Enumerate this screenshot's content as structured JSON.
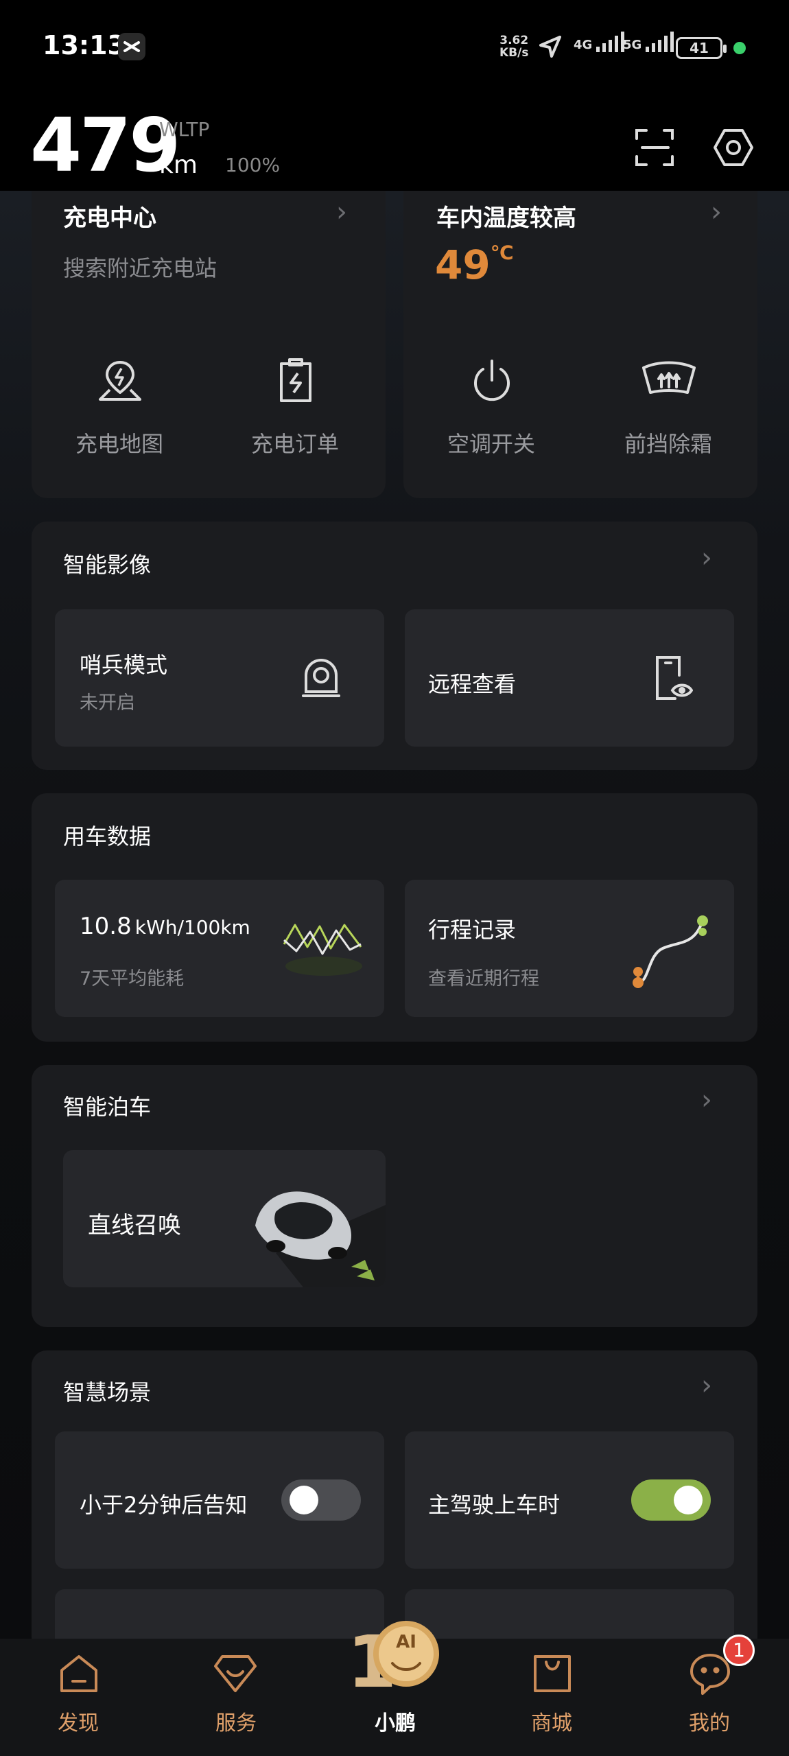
{
  "status_bar": {
    "time": "13:13",
    "net_speed_value": "3.62",
    "net_speed_unit": "KB/s",
    "sig1": "4G",
    "sig2": "5G",
    "battery": "41"
  },
  "header": {
    "range": "479",
    "standard": "WLTP",
    "unit": "km",
    "battery_pct": "100%"
  },
  "charging": {
    "title": "充电中心",
    "subtitle": "搜索附近充电站",
    "map_label": "充电地图",
    "orders_label": "充电订单"
  },
  "climate": {
    "title": "车内温度较高",
    "temp": "49",
    "temp_unit": "℃",
    "ac_label": "空调开关",
    "defrost_label": "前挡除霜"
  },
  "imaging": {
    "title": "智能影像",
    "sentry_title": "哨兵模式",
    "sentry_status": "未开启",
    "remote_view": "远程查看"
  },
  "vehicle_data": {
    "title": "用车数据",
    "energy_value": "10.8",
    "energy_unit": "kWh/100km",
    "energy_desc": "7天平均能耗",
    "trip_title": "行程记录",
    "trip_desc": "查看近期行程"
  },
  "parking": {
    "title": "智能泊车",
    "summon_label": "直线召唤"
  },
  "scenes": {
    "title": "智慧场景",
    "scene1_label": "小于2分钟后告知",
    "scene1_on": false,
    "scene2_label": "主驾驶上车时",
    "scene2_on": true
  },
  "nav": {
    "items": [
      {
        "label": "发现"
      },
      {
        "label": "服务"
      },
      {
        "label": "小鹏"
      },
      {
        "label": "商城"
      },
      {
        "label": "我的"
      }
    ],
    "badge": "1",
    "center_badge": "AI"
  },
  "colors": {
    "accent_orange": "#e0893a",
    "toggle_on": "#8bb048",
    "nav_icon": "#c98a57"
  }
}
